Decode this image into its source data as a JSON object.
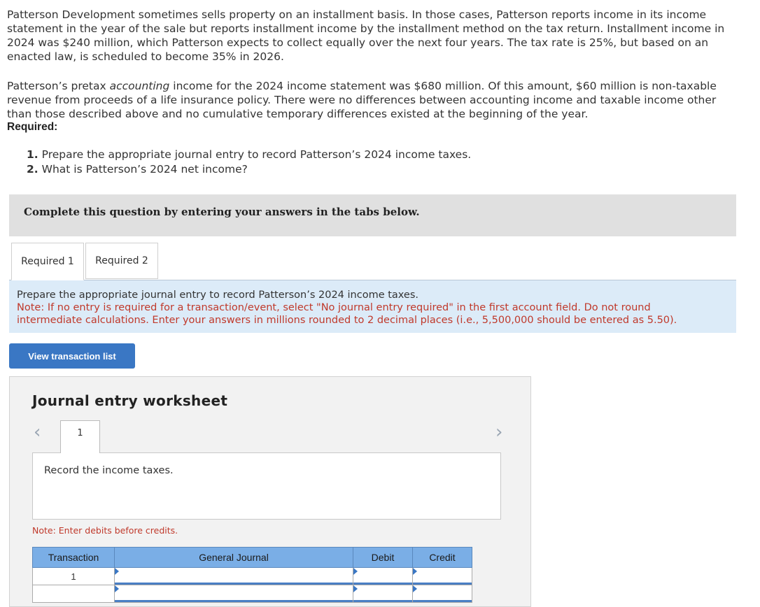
{
  "problem": {
    "p1": "Patterson Development sometimes sells property on an installment basis. In those cases, Patterson reports income in its income statement in the year of the sale but reports installment income by the installment method on the tax return. Installment income in 2024 was $240 million, which Patterson expects to collect equally over the next four years. The tax rate is 25%, but based on an enacted law, is scheduled to become 35% in 2026.",
    "p2_before": "Patterson’s pretax ",
    "p2_em": "accounting",
    "p2_after": " income for the 2024 income statement was $680 million. Of this amount, $60 million is non-taxable revenue from proceeds of a life insurance policy. There were no differences between accounting income and taxable income other than those described above and no cumulative temporary differences existed at the beginning of the year.",
    "required_heading": "Required:",
    "req1_num": "1.",
    "req1_text": " Prepare the appropriate journal entry to record Patterson’s 2024 income taxes.",
    "req2_num": "2.",
    "req2_text": " What is Patterson’s 2024 net income?"
  },
  "banner": "Complete this question by entering your answers in the tabs below.",
  "tabs": [
    {
      "label": "Required 1",
      "active": true
    },
    {
      "label": "Required 2",
      "active": false
    }
  ],
  "instruction": {
    "line1": "Prepare the appropriate journal entry to record Patterson’s 2024 income taxes.",
    "note": "Note: If no entry is required for a transaction/event, select \"No journal entry required\" in the first account field. Do not round intermediate calculations. Enter your answers in millions rounded to 2 decimal places (i.e., 5,500,000 should be entered as 5.50)."
  },
  "view_button": "View transaction list",
  "worksheet": {
    "title": "Journal entry worksheet",
    "entry_tab": "1",
    "description": "Record the income taxes.",
    "note": "Note: Enter debits before credits.",
    "columns": [
      "Transaction",
      "General Journal",
      "Debit",
      "Credit"
    ],
    "rows": [
      {
        "transaction": "1",
        "account": "",
        "debit": "",
        "credit": ""
      },
      {
        "transaction": "",
        "account": "",
        "debit": "",
        "credit": ""
      }
    ]
  },
  "colors": {
    "accent": "#3a77c4",
    "note_red": "#c0392b",
    "instruction_bg": "#dcebf8",
    "table_header": "#7aaee6"
  }
}
